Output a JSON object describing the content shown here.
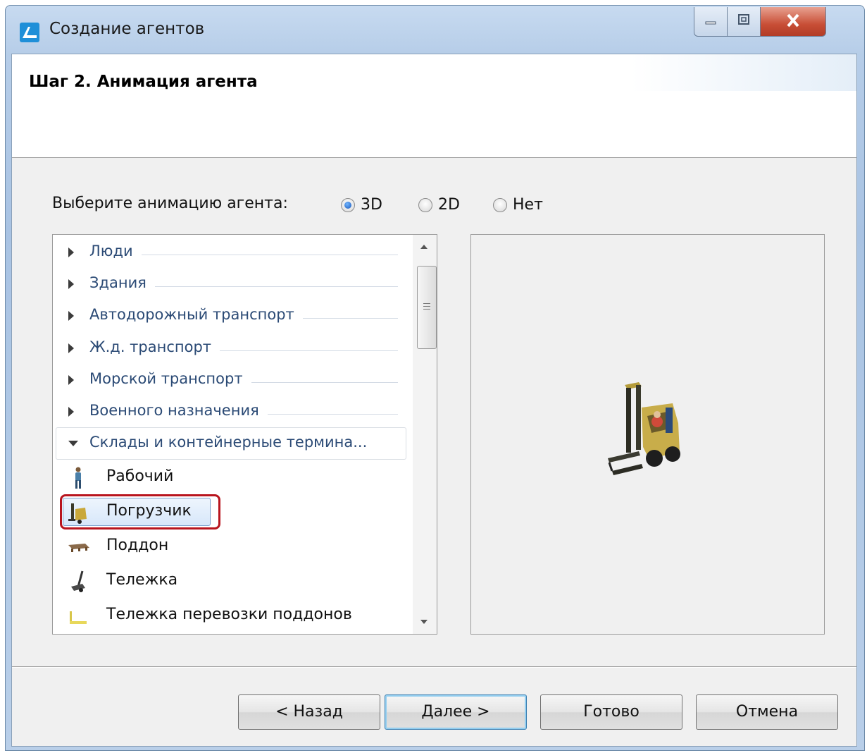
{
  "window": {
    "title": "Создание агентов",
    "controls": {
      "minimize": "—",
      "maximize": "□",
      "close": "X"
    }
  },
  "header": {
    "step_title": "Шаг 2. Анимация агента"
  },
  "animation": {
    "prompt": "Выберите анимацию агента:",
    "options": [
      {
        "label": "3D",
        "selected": true
      },
      {
        "label": "2D",
        "selected": false
      },
      {
        "label": "Нет",
        "selected": false
      }
    ]
  },
  "categories": [
    {
      "label": "Люди",
      "expanded": false
    },
    {
      "label": "Здания",
      "expanded": false
    },
    {
      "label": "Автодорожный транспорт",
      "expanded": false
    },
    {
      "label": "Ж.д. транспорт",
      "expanded": false
    },
    {
      "label": "Морской транспорт",
      "expanded": false
    },
    {
      "label": "Военного назначения",
      "expanded": false
    },
    {
      "label": "Склады и контейнерные термина...",
      "expanded": true
    }
  ],
  "items": [
    {
      "label": "Рабочий",
      "icon": "worker-icon",
      "selected": false
    },
    {
      "label": "Погрузчик",
      "icon": "forklift-icon",
      "selected": true
    },
    {
      "label": "Поддон",
      "icon": "pallet-icon",
      "selected": false
    },
    {
      "label": "Тележка",
      "icon": "hand-truck-icon",
      "selected": false
    },
    {
      "label": "Тележка перевозки поддонов",
      "icon": "pallet-jack-icon",
      "selected": false
    }
  ],
  "preview": {
    "icon": "forklift-3d-preview"
  },
  "buttons": {
    "back": "< Назад",
    "next": "Далее >",
    "finish": "Готово",
    "cancel": "Отмена"
  },
  "colors": {
    "highlight": "#b8141d",
    "link_text": "#2b4a75"
  }
}
